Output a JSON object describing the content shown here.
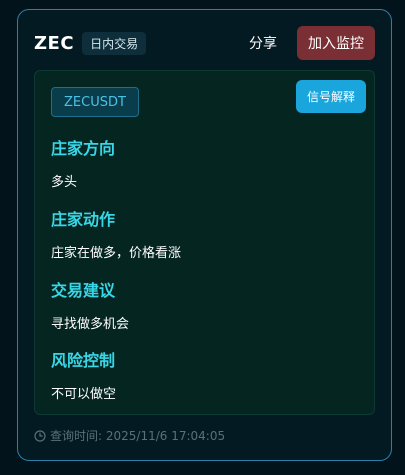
{
  "header": {
    "symbol": "ZEC",
    "tag": "日内交易",
    "share_label": "分享",
    "monitor_label": "加入监控"
  },
  "panel": {
    "pair": "ZECUSDT",
    "explain_label": "信号解释",
    "sections": [
      {
        "title": "庄家方向",
        "value": "多头"
      },
      {
        "title": "庄家动作",
        "value": "庄家在做多，价格看涨"
      },
      {
        "title": "交易建议",
        "value": "寻找做多机会"
      },
      {
        "title": "风险控制",
        "value": "不可以做空"
      }
    ]
  },
  "footer": {
    "query_time": "查询时间: 2025/11/6 17:04:05"
  },
  "colors": {
    "accent_cyan": "#38d6e6",
    "monitor_red": "#7a2f35",
    "explain_blue": "#1aa6dc"
  }
}
